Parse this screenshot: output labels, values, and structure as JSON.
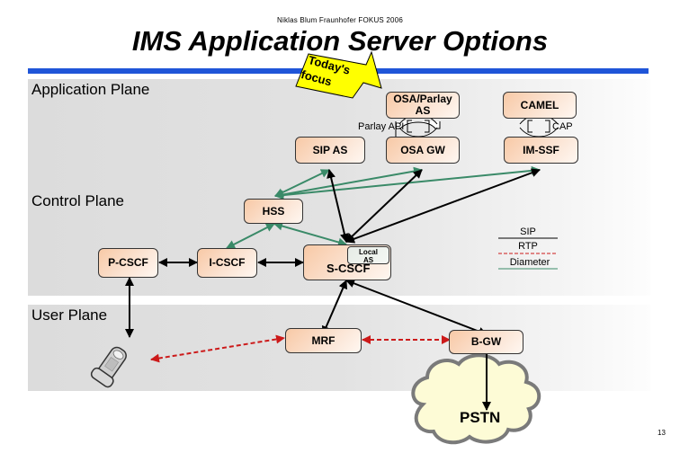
{
  "header": {
    "author": "Niklas Blum Fraunhofer FOKUS 2006",
    "title": "IMS Application Server Options"
  },
  "callout": {
    "line1": "Today's",
    "line2": "focus"
  },
  "planes": {
    "application": "Application Plane",
    "control": "Control Plane",
    "user": "User Plane"
  },
  "nodes": {
    "osa_parlay_as_line1": "OSA/Parlay",
    "osa_parlay_as_line2": "AS",
    "camel": "CAMEL",
    "sip_as": "SIP AS",
    "osa_gw": "OSA GW",
    "im_ssf": "IM-SSF",
    "hss": "HSS",
    "p_cscf": "P-CSCF",
    "i_cscf": "I-CSCF",
    "s_cscf": "S-CSCF",
    "local_as_line1": "Local",
    "local_as_line2": "AS",
    "mrf": "MRF",
    "b_gw": "B-GW",
    "pstn": "PSTN"
  },
  "interfaces": {
    "parlay_api": "Parlay API",
    "cap": "CAP"
  },
  "legend": {
    "sip": "SIP",
    "rtp": "RTP",
    "diameter": "Diameter",
    "colors": {
      "sip": "#000000",
      "rtp": "#cc1a1a",
      "diameter": "#3a8a68"
    }
  },
  "colors": {
    "accent_bar": "#1f55d8",
    "callout": "#ffff00",
    "node_fill": "#f8c9a6",
    "cloud_fill": "#fdfbd6"
  },
  "footer": {
    "page_number": "13"
  }
}
